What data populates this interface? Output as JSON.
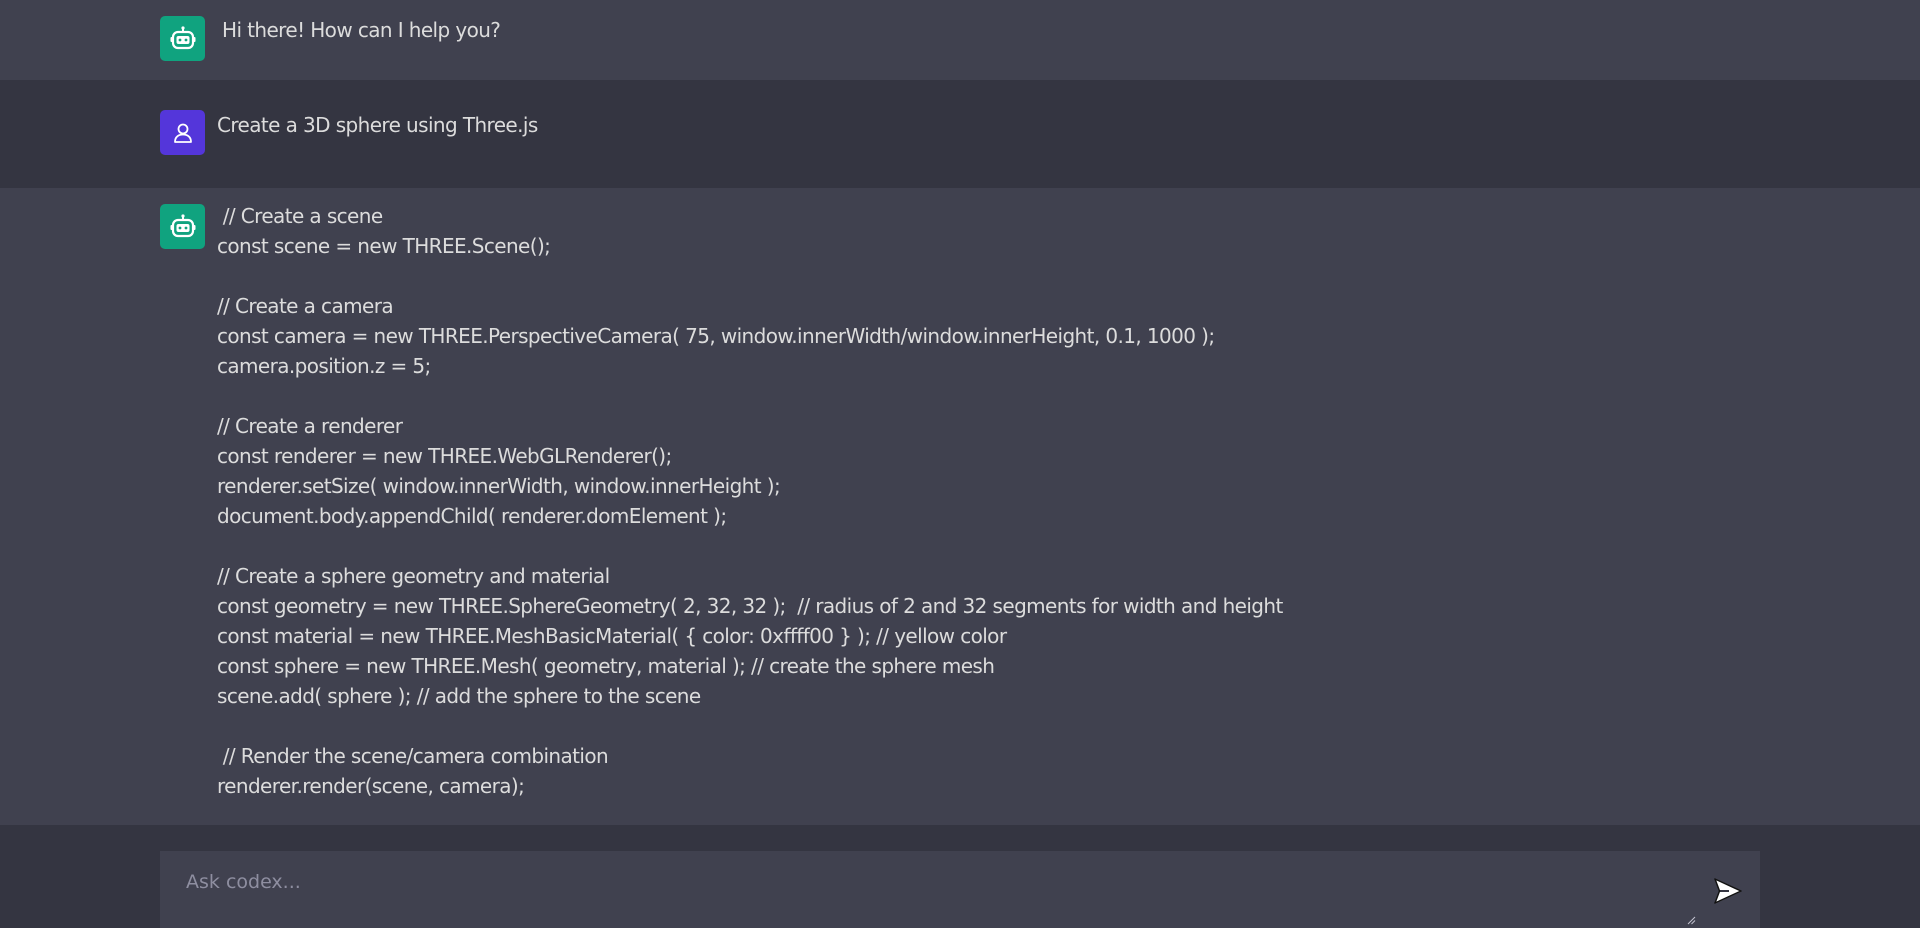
{
  "messages": [
    {
      "role": "bot",
      "avatar_icon": "robot-icon",
      "text": "Hi there! How can I help you?"
    },
    {
      "role": "user",
      "avatar_icon": "user-icon",
      "text": "Create a 3D sphere using Three.js"
    },
    {
      "role": "bot",
      "avatar_icon": "robot-icon",
      "lines": [
        " // Create a scene",
        "const scene = new THREE.Scene();",
        "",
        "// Create a camera",
        "const camera = new THREE.PerspectiveCamera( 75, window.innerWidth/window.innerHeight, 0.1, 1000 );",
        "camera.position.z = 5;",
        "",
        "// Create a renderer",
        "const renderer = new THREE.WebGLRenderer();",
        "renderer.setSize( window.innerWidth, window.innerHeight );",
        "document.body.appendChild( renderer.domElement );",
        "",
        "// Create a sphere geometry and material",
        "const geometry = new THREE.SphereGeometry( 2, 32, 32 );  // radius of 2 and 32 segments for width and height",
        "const material = new THREE.MeshBasicMaterial( { color: 0xffff00 } ); // yellow color",
        "const sphere = new THREE.Mesh( geometry, material ); // create the sphere mesh",
        "scene.add( sphere ); // add the sphere to the scene",
        "",
        " // Render the scene/camera combination",
        "renderer.render(scene, camera);"
      ]
    }
  ],
  "composer": {
    "placeholder": "Ask codex...",
    "value": "",
    "send_icon": "send-icon"
  },
  "colors": {
    "background": "#343541",
    "bot_message_bg": "#40414f",
    "bot_avatar": "#10a37f",
    "user_avatar": "#5436da",
    "text": "#dcdcdc"
  }
}
